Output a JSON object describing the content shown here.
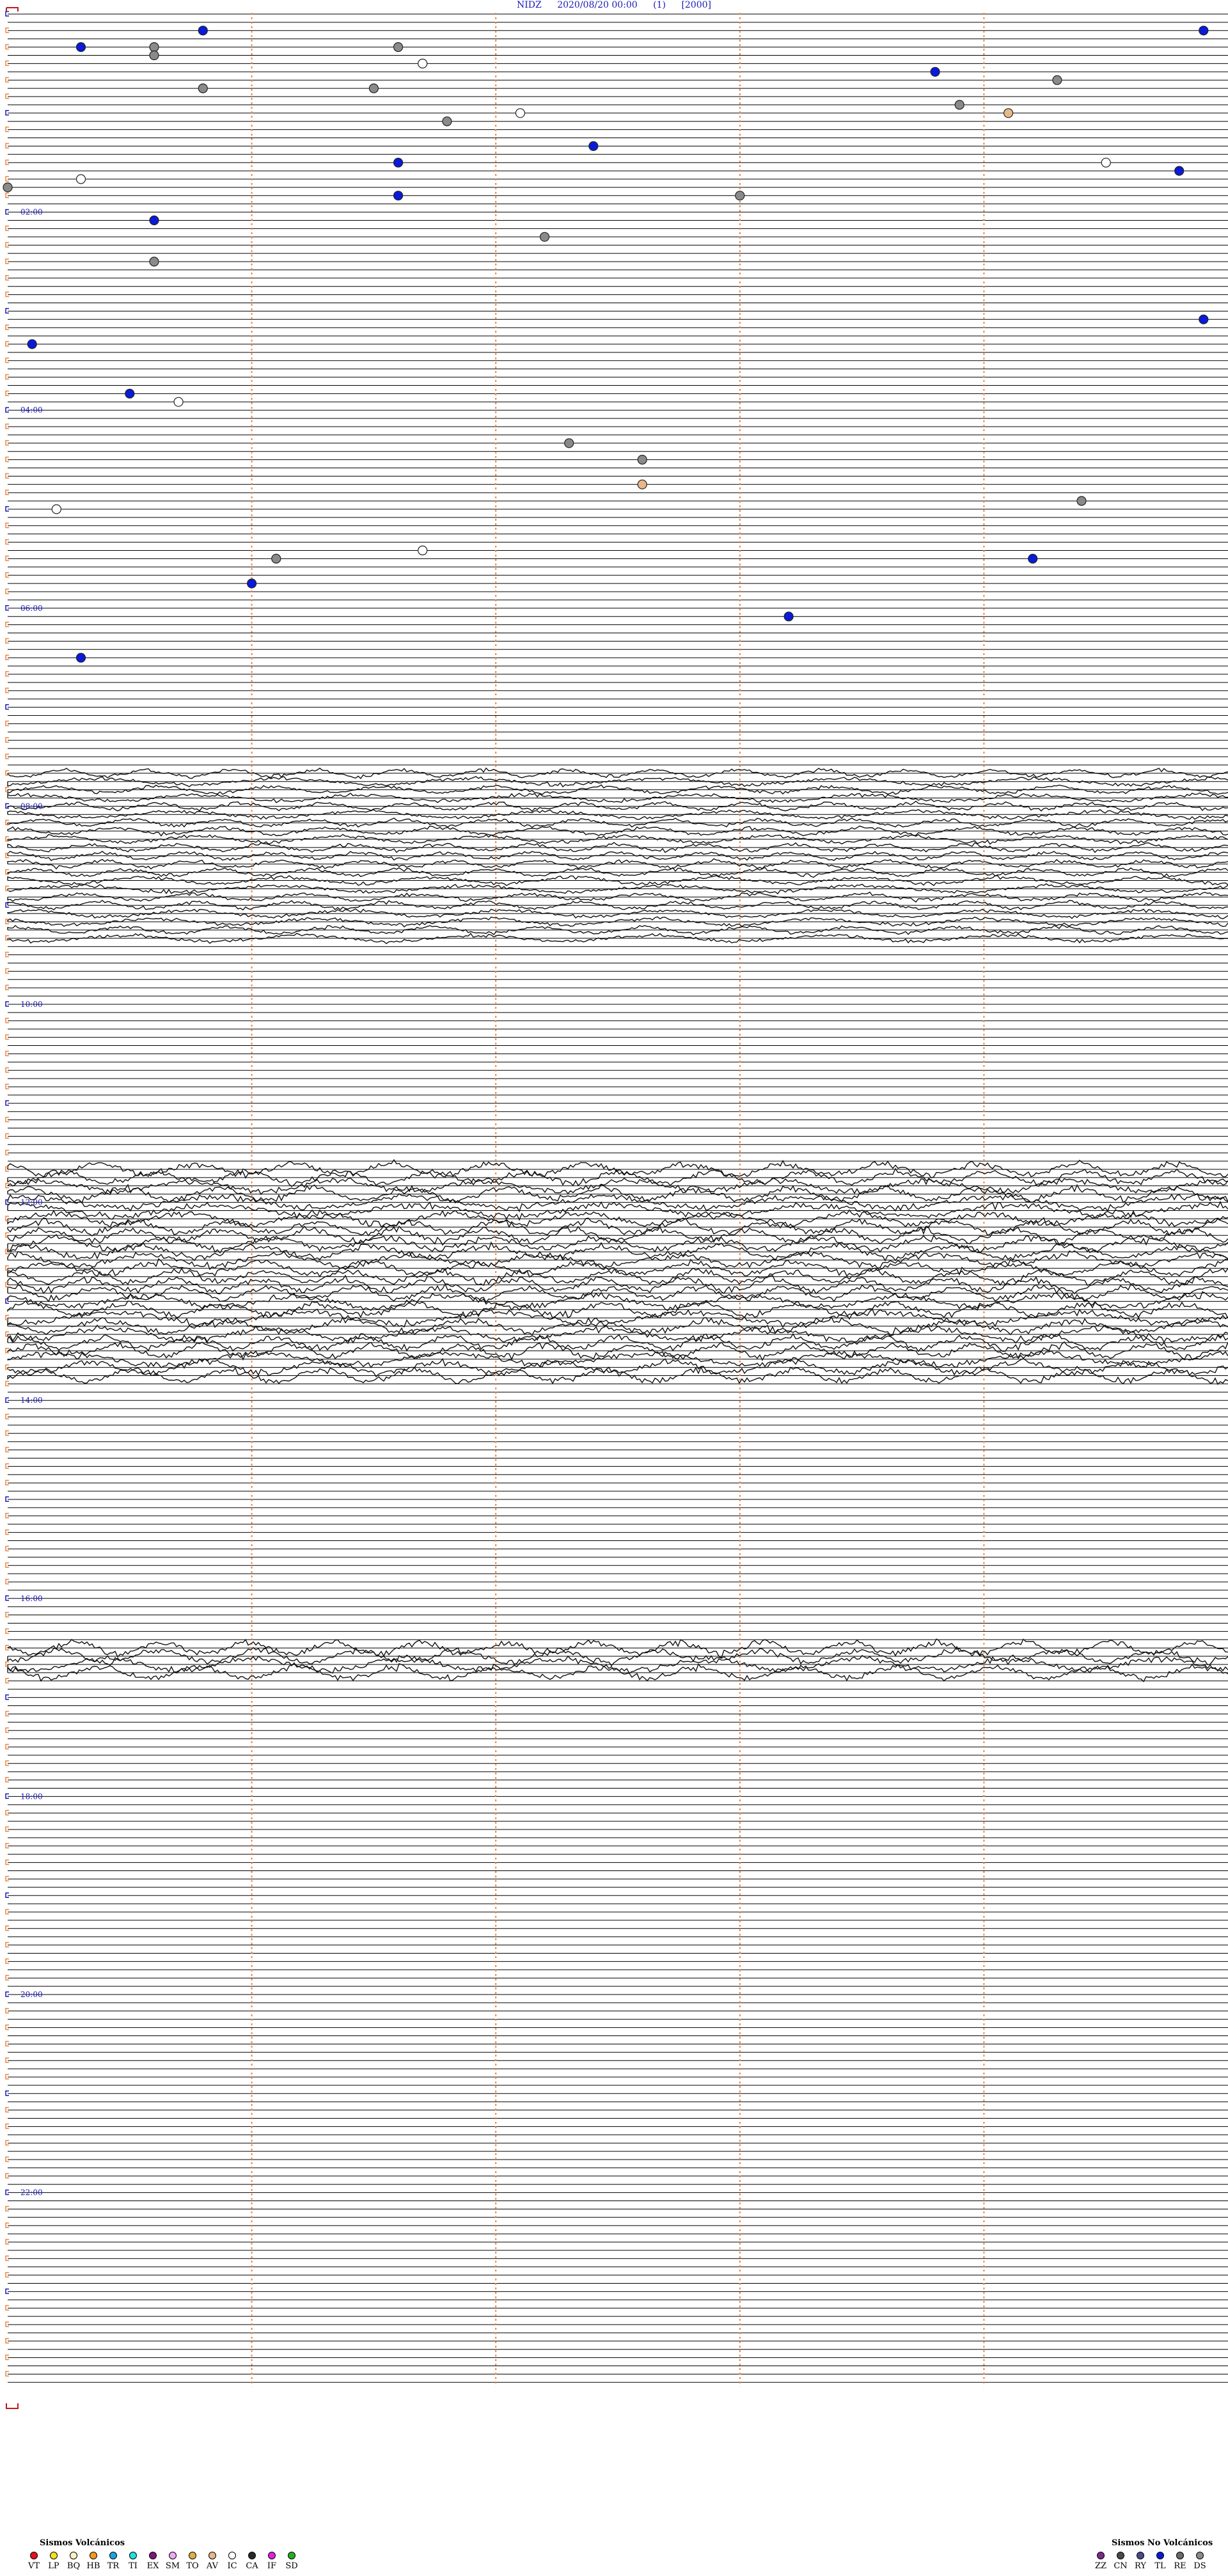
{
  "header": {
    "station": "NIDZ",
    "datetime": "2020/08/20 00:00",
    "channel": "(1)",
    "scale": "[2000]"
  },
  "chart_data": {
    "type": "scatter",
    "title": "NIDZ    2020/08/20 00:00    (1)    [2000]",
    "x_unit": "minutes within trace line",
    "x_range": [
      0,
      5
    ],
    "trace_minutes": 5,
    "hour_labels": [
      "02:00",
      "04:00",
      "06:00",
      "08:00",
      "10:00",
      "12:00",
      "14:00",
      "16:00",
      "18:00",
      "20:00",
      "22:00"
    ],
    "vertical_guides_minutes": [
      1,
      2,
      3,
      4
    ],
    "noisy_periods": [
      {
        "from_minutes": 460,
        "to_minutes": 560,
        "amplitude": "moderate"
      },
      {
        "from_minutes": 700,
        "to_minutes": 825,
        "amplitude": "high"
      },
      {
        "from_minutes": 990,
        "to_minutes": 1005,
        "amplitude": "high"
      }
    ],
    "events": [
      {
        "t_min": 10.8,
        "type": "TL"
      },
      {
        "t_min": 14.9,
        "type": "TL"
      },
      {
        "t_min": 20.6,
        "type": "DS"
      },
      {
        "t_min": 20.3,
        "type": "TL"
      },
      {
        "t_min": 21.6,
        "type": "DS"
      },
      {
        "t_min": 25.6,
        "type": "DS"
      },
      {
        "t_min": 31.7,
        "type": "IC"
      },
      {
        "t_min": 38.8,
        "type": "TL"
      },
      {
        "t_min": 44.3,
        "type": "DS"
      },
      {
        "t_min": 45.8,
        "type": "DS"
      },
      {
        "t_min": 46.5,
        "type": "DS"
      },
      {
        "t_min": 58.9,
        "type": "DS"
      },
      {
        "t_min": 62.1,
        "type": "IC"
      },
      {
        "t_min": 64.1,
        "type": "AV"
      },
      {
        "t_min": 66.8,
        "type": "DS"
      },
      {
        "t_min": 82.4,
        "type": "TL"
      },
      {
        "t_min": 91.6,
        "type": "TL"
      },
      {
        "t_min": 94.5,
        "type": "IC"
      },
      {
        "t_min": 99.8,
        "type": "TL"
      },
      {
        "t_min": 100.3,
        "type": "IC"
      },
      {
        "t_min": 105.0,
        "type": "DS"
      },
      {
        "t_min": 111.6,
        "type": "TL"
      },
      {
        "t_min": 113.0,
        "type": "DS"
      },
      {
        "t_min": 125.6,
        "type": "TL"
      },
      {
        "t_min": 137.2,
        "type": "DS"
      },
      {
        "t_min": 150.6,
        "type": "DS"
      },
      {
        "t_min": 189.9,
        "type": "TL"
      },
      {
        "t_min": 200.1,
        "type": "TL"
      },
      {
        "t_min": 230.5,
        "type": "TL"
      },
      {
        "t_min": 235.7,
        "type": "IC"
      },
      {
        "t_min": 262.3,
        "type": "DS"
      },
      {
        "t_min": 272.6,
        "type": "DS"
      },
      {
        "t_min": 287.6,
        "type": "AV"
      },
      {
        "t_min": 299.4,
        "type": "DS"
      },
      {
        "t_min": 300.2,
        "type": "IC"
      },
      {
        "t_min": 326.7,
        "type": "IC"
      },
      {
        "t_min": 331.1,
        "type": "DS"
      },
      {
        "t_min": 334.2,
        "type": "TL"
      },
      {
        "t_min": 346.0,
        "type": "TL"
      },
      {
        "t_min": 368.2,
        "type": "TL"
      },
      {
        "t_min": 390.3,
        "type": "TL"
      }
    ]
  },
  "legend_volcanic": {
    "title": "Sismos Volcánicos",
    "items": [
      {
        "label": "VT",
        "color": "#e8121b"
      },
      {
        "label": "LP",
        "color": "#f2e21a"
      },
      {
        "label": "BQ",
        "color": "#f7f2c0"
      },
      {
        "label": "HB",
        "color": "#f39a1e"
      },
      {
        "label": "TR",
        "color": "#1aa3e0"
      },
      {
        "label": "TI",
        "color": "#20e0e0"
      },
      {
        "label": "EX",
        "color": "#7a1a7a"
      },
      {
        "label": "SM",
        "color": "#f0a8f0"
      },
      {
        "label": "TO",
        "color": "#e0b040"
      },
      {
        "label": "AV",
        "color": "#e8b888"
      },
      {
        "label": "IC",
        "color": "#ffffff"
      },
      {
        "label": "CA",
        "color": "#2a2a2a"
      },
      {
        "label": "IF",
        "color": "#e020e0"
      },
      {
        "label": "SD",
        "color": "#22b022"
      }
    ]
  },
  "legend_nonvolcanic": {
    "title": "Sismos No Volcánicos",
    "items": [
      {
        "label": "ZZ",
        "color": "#7a2a8a"
      },
      {
        "label": "CN",
        "color": "#4a4a4a"
      },
      {
        "label": "RY",
        "color": "#4a4a8a"
      },
      {
        "label": "TL",
        "color": "#0a1ad8"
      },
      {
        "label": "RE",
        "color": "#6a6a6a"
      },
      {
        "label": "DS",
        "color": "#8a8a8a"
      }
    ]
  }
}
